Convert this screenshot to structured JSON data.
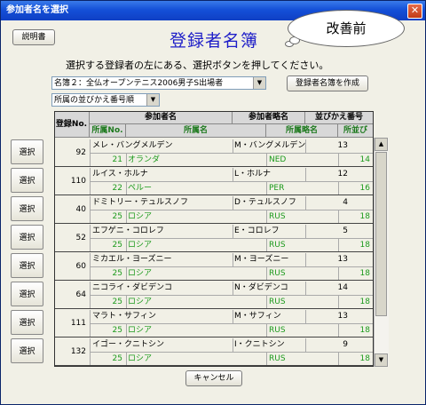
{
  "window": {
    "title": "参加者名を選択",
    "close_glyph": "✕"
  },
  "toolbar": {
    "help_label": "説明書"
  },
  "heading": "登録者名簿",
  "callout": "改善前",
  "instruction": "選択する登録者の左にある、選択ボタンを押してください。",
  "list_select": {
    "value": "名簿２：全仏オープンテニス2006男子S出場者"
  },
  "create_list_button": "登録者名簿を作成",
  "sort_select": {
    "value": "所属の並びかえ番号順"
  },
  "headers": {
    "reg_no": "登録No.",
    "participant_name": "参加者名",
    "participant_short": "参加者略名",
    "sort_no": "並びかえ番号",
    "aff_no": "所属No.",
    "aff_name": "所属名",
    "aff_short": "所属略名",
    "aff_order": "所並び"
  },
  "select_label": "選択",
  "rows": [
    {
      "reg_no": "92",
      "name": "メレ・バングメルデン",
      "short": "M・バングメルデン",
      "sort": "13",
      "aff_no": "21",
      "aff_name": "オランダ",
      "aff_short": "NED",
      "aff_order": "14"
    },
    {
      "reg_no": "110",
      "name": "ルイス・ホルナ",
      "short": "L・ホルナ",
      "sort": "12",
      "aff_no": "22",
      "aff_name": "ペルー",
      "aff_short": "PER",
      "aff_order": "16"
    },
    {
      "reg_no": "40",
      "name": "ドミトリー・テュルスノフ",
      "short": "D・テュルスノフ",
      "sort": "4",
      "aff_no": "25",
      "aff_name": "ロシア",
      "aff_short": "RUS",
      "aff_order": "18"
    },
    {
      "reg_no": "52",
      "name": "エフゲニ・コロレフ",
      "short": "E・コロレフ",
      "sort": "5",
      "aff_no": "25",
      "aff_name": "ロシア",
      "aff_short": "RUS",
      "aff_order": "18"
    },
    {
      "reg_no": "60",
      "name": "ミカエル・ヨーズニー",
      "short": "M・ヨーズニー",
      "sort": "13",
      "aff_no": "25",
      "aff_name": "ロシア",
      "aff_short": "RUS",
      "aff_order": "18"
    },
    {
      "reg_no": "64",
      "name": "ニコライ・ダビデンコ",
      "short": "N・ダビデンコ",
      "sort": "14",
      "aff_no": "25",
      "aff_name": "ロシア",
      "aff_short": "RUS",
      "aff_order": "18"
    },
    {
      "reg_no": "111",
      "name": "マラト・サフィン",
      "short": "M・サフィン",
      "sort": "13",
      "aff_no": "25",
      "aff_name": "ロシア",
      "aff_short": "RUS",
      "aff_order": "18"
    },
    {
      "reg_no": "132",
      "name": "イゴー・クニトシン",
      "short": "I・クニトシン",
      "sort": "9",
      "aff_no": "25",
      "aff_name": "ロシア",
      "aff_short": "RUS",
      "aff_order": "18"
    }
  ],
  "cancel_label": "キャンセル",
  "colors": {
    "title_bar": "#1450d8",
    "heading": "#1e1ec8",
    "affiliation_text": "#1c9a1c"
  }
}
